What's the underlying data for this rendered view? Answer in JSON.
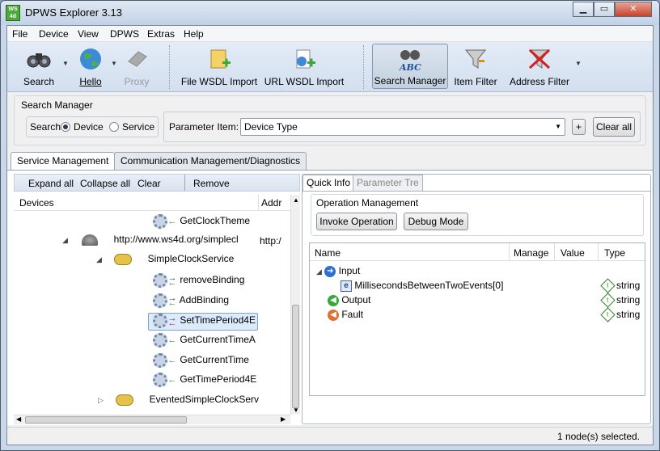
{
  "window": {
    "title": "DPWS Explorer 3.13",
    "icon_text": "WS 4d"
  },
  "menu": [
    "File",
    "Device",
    "View",
    "DPWS",
    "Extras",
    "Help"
  ],
  "toolbar": {
    "search": "Search",
    "hello": "Hello",
    "proxy": "Proxy",
    "file_wsdl": "File WSDL Import",
    "url_wsdl": "URL WSDL Import",
    "search_manager": "Search Manager",
    "item_filter": "Item Filter",
    "address_filter": "Address Filter"
  },
  "search_manager": {
    "title": "Search Manager",
    "search_label": "Search",
    "opt_device": "Device",
    "opt_service": "Service",
    "param_label": "Parameter Item:",
    "param_value": "Device Type",
    "plus": "+",
    "clear_all": "Clear all"
  },
  "tabs": [
    "Service Management",
    "Communication Management/Diagnostics"
  ],
  "left_toolbar": {
    "expand": "Expand all",
    "collapse": "Collapse all",
    "clear": "Clear",
    "remove": "Remove"
  },
  "columns": {
    "devices": "Devices",
    "address": "Addr"
  },
  "tree": {
    "r1": "GetClockTheme",
    "r2a": "http://www.ws4d.org/simplecl",
    "r2b": "http:/",
    "r3": "SimpleClockService",
    "r4": "removeBinding",
    "r5": "AddBinding",
    "r6": "SetTimePeriod4E",
    "r7": "GetCurrentTimeA",
    "r8": "GetCurrentTime",
    "r9": "GetTimePeriod4E",
    "r10": "EventedSimpleClockServ"
  },
  "right_tabs": {
    "quick": "Quick Info",
    "param": "Parameter Tre"
  },
  "operation": {
    "title": "Operation Management",
    "invoke": "Invoke Operation",
    "debug": "Debug Mode"
  },
  "params": {
    "cols": {
      "name": "Name",
      "manage": "Manage",
      "value": "Value",
      "type": "Type"
    },
    "input": "Input",
    "element": "MillisecondsBetweenTwoEvents[0]",
    "output": "Output",
    "fault": "Fault",
    "type_string": "string"
  },
  "status": "1 node(s) selected."
}
